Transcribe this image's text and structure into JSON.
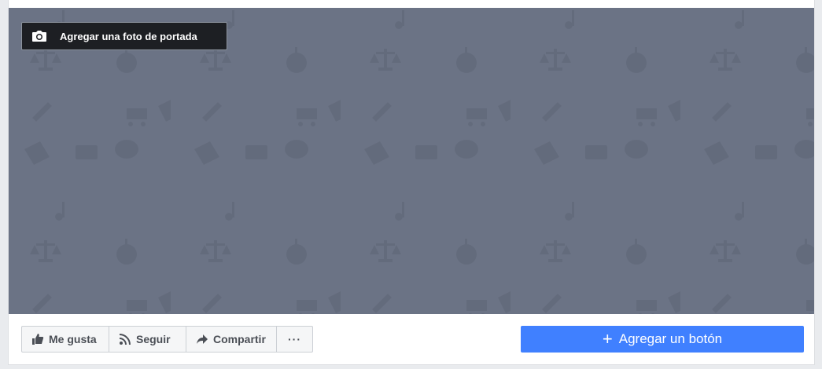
{
  "cover": {
    "add_photo_label": "Agregar una foto de portada",
    "background_color": "#6b7385"
  },
  "actions": {
    "like_label": "Me gusta",
    "follow_label": "Seguir",
    "share_label": "Compartir",
    "more_label": "···"
  },
  "cta": {
    "plus": "+",
    "label": "Agregar un botón",
    "color": "#4080ff"
  },
  "icons": [
    "camera-icon",
    "thumbs-up-icon",
    "rss-icon",
    "share-arrow-icon",
    "more-icon",
    "plus-icon"
  ]
}
